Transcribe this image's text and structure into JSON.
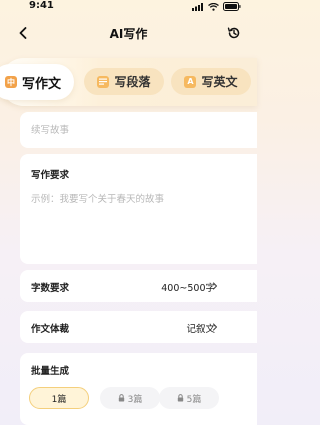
{
  "status_bar": {
    "time": "9:41"
  },
  "nav": {
    "title": "AI写作"
  },
  "tabs": [
    {
      "label": "写作文",
      "icon": "中",
      "active": true
    },
    {
      "label": "写段落",
      "icon": "paragraph-icon",
      "active": false
    },
    {
      "label": "写英文",
      "icon": "A",
      "active": false
    }
  ],
  "topic": {
    "placeholder": "续写故事"
  },
  "requirements": {
    "label": "写作要求",
    "placeholder": "示例：我要写个关于春天的故事"
  },
  "word_count": {
    "label": "字数要求",
    "value": "400~500字"
  },
  "essay_style": {
    "label": "作文体裁",
    "value": "记叙文"
  },
  "batch": {
    "label": "批量生成",
    "options": [
      {
        "label": "1篇",
        "locked": false,
        "selected": true
      },
      {
        "label": "3篇",
        "locked": true,
        "selected": false
      },
      {
        "label": "5篇",
        "locked": true,
        "selected": false
      }
    ]
  },
  "colors": {
    "accent": "#f2a24a",
    "tab_pill": "#f8e3bf",
    "selected_option_border": "#f4cf7c"
  }
}
